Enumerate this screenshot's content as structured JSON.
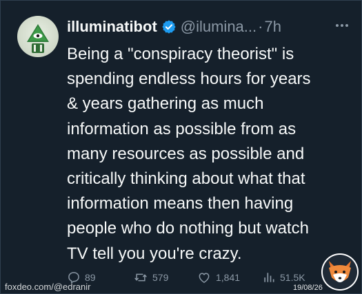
{
  "tweet": {
    "display_name": "illuminatibot",
    "handle": "@ilumina...",
    "separator": "·",
    "time": "7h",
    "text_lines": [
      "Being a \"conspiracy theorist\" is",
      "spending endless hours for years",
      "& years gathering as much",
      "information as possible from as",
      "many resources as possible and",
      "critically thinking about what that",
      "information means then having",
      "people who do nothing but watch",
      "TV tell you you're crazy."
    ]
  },
  "actions": {
    "replies": "89",
    "retweets": "579",
    "likes": "1,841",
    "views": "51.5K"
  },
  "watermark": {
    "source": "foxdeo.com/@edranir",
    "date": "19/08/26"
  },
  "icons": {
    "avatar": "illuminati-eye-pyramid-icon",
    "verified": "verified-badge-icon",
    "more": "more-options-icon",
    "reply": "reply-icon",
    "retweet": "retweet-icon",
    "like": "heart-icon",
    "views": "views-bar-chart-icon",
    "logo": "fox-logo"
  },
  "colors": {
    "background": "#15202b",
    "text": "#f7f9f9",
    "muted": "#8b98a5",
    "verified": "#1d9bf0"
  }
}
